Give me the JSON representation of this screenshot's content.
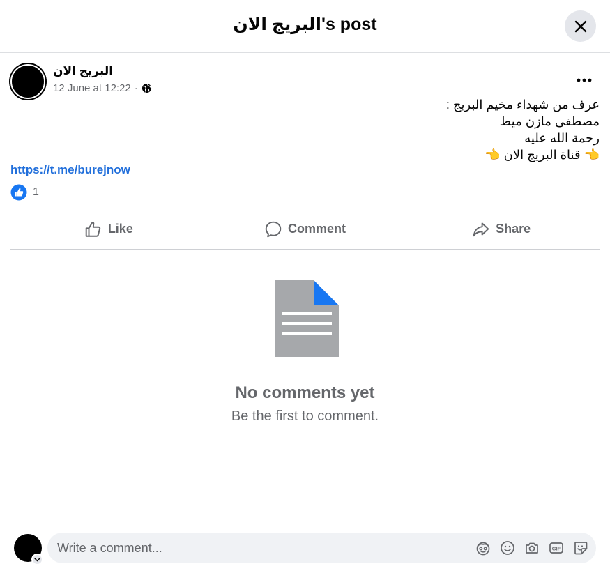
{
  "dialog": {
    "title": "البريج الان's post"
  },
  "post": {
    "author": "البريج الان",
    "timestamp": "12 June at 12:22",
    "separator": "·",
    "privacy_icon": "globe-icon",
    "text_lines": [
      "عرف من شهداء مخيم البريج :",
      "مصطفى مازن ميط",
      "رحمة الله عليه",
      "👈 قناة البريج الان 👈"
    ],
    "link": "https://t.me/burejnow",
    "reaction_icon": "like-reaction-icon",
    "reaction_count": "1"
  },
  "actions": {
    "like": "Like",
    "comment": "Comment",
    "share": "Share"
  },
  "empty_state": {
    "title": "No comments yet",
    "subtitle": "Be the first to comment."
  },
  "composer": {
    "placeholder": "Write a comment...",
    "tools": [
      "avatar-sticker-icon",
      "emoji-icon",
      "camera-icon",
      "gif-icon",
      "sticker-icon"
    ]
  },
  "colors": {
    "accent": "#1877f2",
    "link": "#216fdb",
    "secondary_text": "#65676b",
    "button_bg": "#e4e6eb",
    "document_gray": "#a6a8ab"
  }
}
